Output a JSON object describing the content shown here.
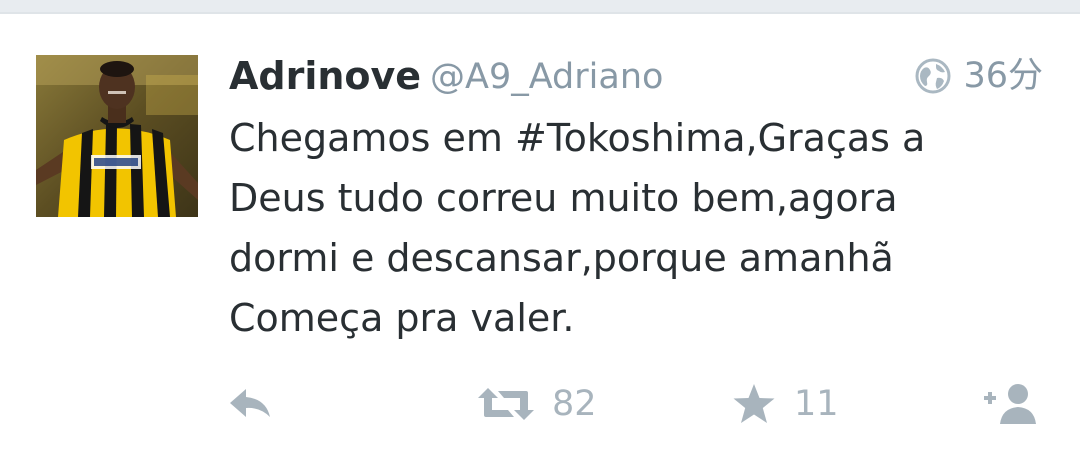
{
  "tweet": {
    "display_name": "Adrinove",
    "handle": "@A9_Adriano",
    "timestamp": "36分",
    "text": "Chegamos em #Tokoshima,Graças a\nDeus tudo correu muito bem,agora\ndormi e descansar,porque amanhã\nComeça pra valer.",
    "retweet_count": "82",
    "favorite_count": "11"
  },
  "colors": {
    "text": "#292f33",
    "muted": "#8899a6",
    "action_icon": "#a8b4bd",
    "jersey_yellow": "#f2c400",
    "jersey_black": "#151515"
  },
  "icons": {
    "privacy": "globe-icon",
    "reply": "reply-icon",
    "retweet": "retweet-icon",
    "favorite": "star-icon",
    "follow": "add-user-icon"
  }
}
